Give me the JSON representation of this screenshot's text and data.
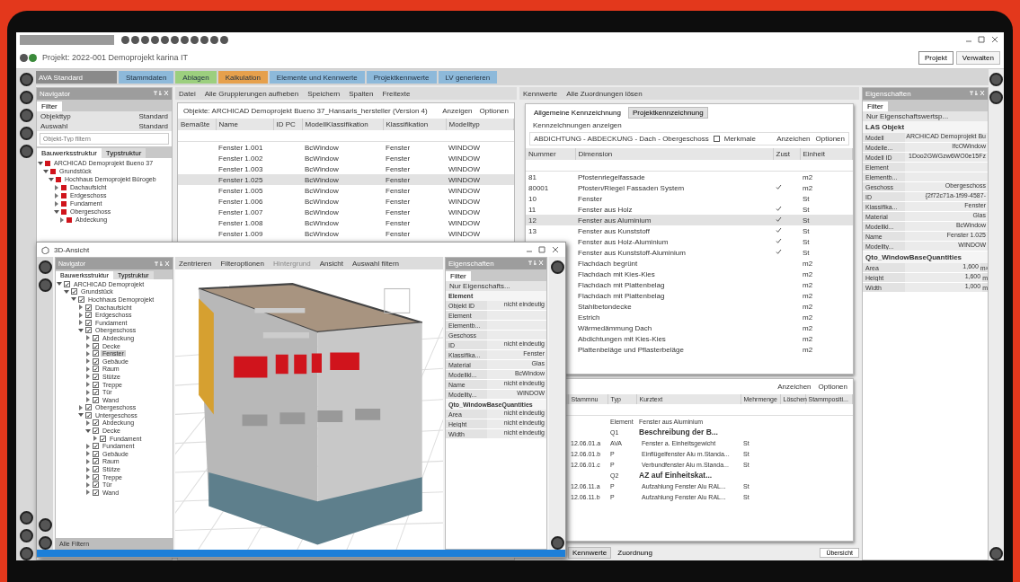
{
  "header": {
    "title": "Projekt: 2022-001 Demoprojekt karina IT",
    "tabs": [
      {
        "label": "Projekt",
        "selected": true
      },
      {
        "label": "Verwalten",
        "selected": false
      }
    ]
  },
  "ribbon": {
    "dropdown": "AVA Standard",
    "tabs": [
      {
        "label": "Stammdaten",
        "color": "#8db9da"
      },
      {
        "label": "Ablagen",
        "color": "#9ccf7e"
      },
      {
        "label": "Kalkulation",
        "color": "#e6a04c"
      },
      {
        "label": "Elemente und Kennwerte",
        "color": "#8db9da"
      },
      {
        "label": "Projektkennwerte",
        "color": "#8db9da"
      },
      {
        "label": "LV generieren",
        "color": "#8db9da"
      }
    ]
  },
  "navigator": {
    "title": "Navigator",
    "filter_tab": "Filter",
    "filters": [
      {
        "label": "Objekttyp",
        "value": "Standard"
      },
      {
        "label": "Auswahl",
        "value": "Standard"
      }
    ],
    "search": {
      "placeholder": "Objekt-Typ filtern"
    },
    "tabs": [
      {
        "label": "Bauwerksstruktur",
        "selected": true
      },
      {
        "label": "Typstruktur",
        "selected": false
      }
    ],
    "tree": [
      {
        "label": "ARCHICAD Demoprojekt Bueno 37",
        "expanded": true,
        "selected": false,
        "children": [
          {
            "label": "Grundstück",
            "expanded": true,
            "selected": false,
            "children": [
              {
                "label": "Hochhaus Demoprojekt Bürogeb",
                "expanded": true,
                "selected": false,
                "children": [
                  {
                    "label": "Dachaufsicht",
                    "expanded": false,
                    "selected": false
                  },
                  {
                    "label": "Erdgeschoss",
                    "expanded": false,
                    "selected": false
                  },
                  {
                    "label": "Fundament",
                    "expanded": false,
                    "selected": false
                  },
                  {
                    "label": "Obergeschoss",
                    "expanded": true,
                    "selected": false,
                    "children": [
                      {
                        "label": "Abdeckung",
                        "expanded": false,
                        "selected": false
                      }
                    ]
                  }
                ]
              }
            ]
          }
        ]
      }
    ]
  },
  "center": {
    "toolbar": [
      "Datei",
      "Alle Gruppierungen aufheben",
      "Speichern",
      "Spalten",
      "Freitexte"
    ],
    "caption": "Objekte: ARCHICAD Demoprojekt Bueno 37_Hansaris_hersteller (Version 4)",
    "actions": [
      "Anzeigen",
      "Optionen"
    ],
    "columns": [
      "Bemaßte",
      "Name",
      "ID PC",
      "ModellKlassifikation",
      "Klassifikation",
      "Modelltyp"
    ],
    "rows": [
      {
        "cells": [
          "",
          "Fenster 1.001",
          "",
          "BcWindow",
          "Fenster",
          "WINDOW"
        ],
        "selected": false
      },
      {
        "cells": [
          "",
          "Fenster 1.002",
          "",
          "BcWindow",
          "Fenster",
          "WINDOW"
        ],
        "selected": false
      },
      {
        "cells": [
          "",
          "Fenster 1.003",
          "",
          "BcWindow",
          "Fenster",
          "WINDOW"
        ],
        "selected": false
      },
      {
        "cells": [
          "",
          "Fenster 1.025",
          "",
          "BcWindow",
          "Fenster",
          "WINDOW"
        ],
        "selected": true
      },
      {
        "cells": [
          "",
          "Fenster 1.005",
          "",
          "BcWindow",
          "Fenster",
          "WINDOW"
        ],
        "selected": false
      },
      {
        "cells": [
          "",
          "Fenster 1.006",
          "",
          "BcWindow",
          "Fenster",
          "WINDOW"
        ],
        "selected": false
      },
      {
        "cells": [
          "",
          "Fenster 1.007",
          "",
          "BcWindow",
          "Fenster",
          "WINDOW"
        ],
        "selected": false
      },
      {
        "cells": [
          "",
          "Fenster 1.008",
          "",
          "BcWindow",
          "Fenster",
          "WINDOW"
        ],
        "selected": false
      },
      {
        "cells": [
          "",
          "Fenster 1.009",
          "",
          "BcWindow",
          "Fenster",
          "WINDOW"
        ],
        "selected": false
      }
    ]
  },
  "middle": {
    "toolbar": [
      "Kennwerte",
      "Alle Zuordnungen lösen"
    ],
    "tabs": [
      {
        "label": "Allgemeine Kennzeichnung",
        "selected": false
      },
      {
        "label": "Projektkennzeichnung",
        "selected": true
      }
    ],
    "hint": "Kennzeichnungen anzeigen",
    "filter_path": "ABDICHTUNG - ABDECKUNG - Dach - Obergeschoss",
    "filter_check": {
      "label": "Merkmale",
      "checked": false
    },
    "actions": [
      "Anzeichen",
      "Optionen"
    ],
    "columns": [
      "Nummer",
      "Dimension",
      "Zust",
      "Einheit"
    ],
    "rows": [
      {
        "number": "81",
        "name": "Pfostenriegelfassade",
        "checked": false,
        "unit": "m2",
        "selected": false
      },
      {
        "number": "80001",
        "name": "Pfosten/Riegel Fassaden System",
        "checked": true,
        "unit": "m2",
        "selected": false
      },
      {
        "number": "10",
        "name": "Fenster",
        "checked": false,
        "unit": "St",
        "selected": false
      },
      {
        "number": "11",
        "name": "Fenster aus Holz",
        "checked": true,
        "unit": "St",
        "selected": false
      },
      {
        "number": "12",
        "name": "Fenster aus Aluminium",
        "checked": true,
        "unit": "St",
        "selected": true
      },
      {
        "number": "13",
        "name": "Fenster aus Kunststoff",
        "checked": true,
        "unit": "St",
        "selected": false
      },
      {
        "name": "Fenster aus Holz-Aluminium",
        "checked": true,
        "unit": "St",
        "selected": false
      },
      {
        "name": "Fenster aus Kunststoff-Aluminium",
        "checked": true,
        "unit": "St",
        "selected": false
      },
      {
        "name": "Flachdach begrünt",
        "checked": false,
        "unit": "m2",
        "selected": false
      },
      {
        "name": "Flachdach mit Kies-Kies",
        "checked": false,
        "unit": "m2",
        "selected": false
      },
      {
        "name": "Flachdach mit Plattenbelag",
        "checked": false,
        "unit": "m2",
        "selected": false
      },
      {
        "name": "Flachdach mit Plattenbelag",
        "checked": false,
        "unit": "m2",
        "selected": false
      },
      {
        "name": "Stahlbetondecke",
        "checked": false,
        "unit": "m2",
        "selected": false
      },
      {
        "name": "Estrich",
        "checked": false,
        "unit": "m2",
        "selected": false
      },
      {
        "name": "Wärmedämmung Dach",
        "checked": false,
        "unit": "m2",
        "selected": false
      },
      {
        "name": "Abdichtungen mit Kies-Kies",
        "checked": false,
        "unit": "m2",
        "selected": false
      },
      {
        "name": "Plattenbeläge und Pflasterbeläge",
        "checked": false,
        "unit": "m2",
        "selected": false
      }
    ]
  },
  "positions": {
    "actions": [
      "Anzeichen",
      "Optionen"
    ],
    "columns": [
      "Stammnu",
      "Typ",
      "Kurztext",
      "Mehrmenge",
      "Löschen",
      "Stammpositi..."
    ],
    "rows": [
      {
        "kind": "element",
        "type": "Element",
        "text": "Fenster aus Aluminium"
      },
      {
        "kind": "heading",
        "type": "Q1",
        "text": "Beschreibung der B..."
      },
      {
        "kind": "item",
        "code": "12.06.01.a",
        "type": "AVA",
        "text": "Fenster a. Einheitsgewicht",
        "unit": "St"
      },
      {
        "kind": "item",
        "code": "12.06.01.b",
        "type": "P",
        "text": "Einflügelfenster Alu m.Standa...",
        "unit": "St"
      },
      {
        "kind": "item",
        "code": "12.06.01.c",
        "type": "P",
        "text": "Verbundfenster Alu m.Standa...",
        "unit": "St"
      },
      {
        "kind": "heading",
        "type": "Q2",
        "text": "AZ auf Einheitskat..."
      },
      {
        "kind": "item",
        "code": "12.06.11.a",
        "type": "P",
        "text": "Aufzahlung Fenster Alu RAL...",
        "unit": "St"
      },
      {
        "kind": "item",
        "code": "12.06.11.b",
        "type": "P",
        "text": "Aufzahlung Fenster Alu RAL...",
        "unit": "St"
      }
    ],
    "footer_tabs": [
      {
        "label": "Kennwerte",
        "selected": true
      },
      {
        "label": "Zuordnung",
        "selected": false
      }
    ],
    "view_select": "Übersicht"
  },
  "properties": {
    "title": "Eigenschaften",
    "filter_tab": "Filter",
    "dropdown": "Nur Eigenschaftswertsp...",
    "section": "LAS Objekt",
    "rows": [
      [
        "Modell",
        "ARCHICAD Demoprojekt Bu"
      ],
      [
        "Modelle...",
        "IfcOWindow"
      ],
      [
        "Modell ID",
        "1Doo2GWGzw6WO0e15Fz"
      ],
      [
        "Element",
        ""
      ],
      [
        "Elementb...",
        ""
      ],
      [
        "Geschoss",
        "Obergeschoss"
      ],
      [
        "ID",
        "{2f72c71a-1f99-4587-"
      ],
      [
        "Klassifika...",
        "Fenster"
      ],
      [
        "Material",
        "Glas"
      ],
      [
        "Modellkl...",
        "BcWindow"
      ],
      [
        "Name",
        "Fenster 1.025"
      ],
      [
        "Modellty...",
        "WINDOW"
      ]
    ],
    "group": "Qto_WindowBaseQuantities",
    "quantities": [
      [
        "Area",
        "1,600",
        "m²"
      ],
      [
        "Height",
        "1,600",
        "m"
      ],
      [
        "Width",
        "1,000",
        "m"
      ]
    ]
  },
  "view_3d": {
    "title": "3D-Ansicht",
    "navigator": {
      "title": "Navigator",
      "tabs": [
        {
          "label": "Bauwerksstruktur",
          "selected": true
        },
        {
          "label": "Typstruktur",
          "selected": false
        }
      ],
      "tree": [
        {
          "label": "ARCHICAD Demoprojekt",
          "expanded": true,
          "checked": true,
          "selected": false,
          "children": [
            {
              "label": "Grundstück",
              "expanded": true,
              "checked": true,
              "selected": false,
              "children": [
                {
                  "label": "Hochhaus Demoprojekt",
                  "expanded": true,
                  "checked": true,
                  "selected": false,
                  "children": [
                    {
                      "label": "Dachaufsicht",
                      "expanded": false,
                      "checked": true,
                      "selected": false
                    },
                    {
                      "label": "Erdgeschoss",
                      "expanded": false,
                      "checked": true,
                      "selected": false
                    },
                    {
                      "label": "Fundament",
                      "expanded": false,
                      "checked": true,
                      "selected": false
                    },
                    {
                      "label": "Obergeschoss",
                      "expanded": true,
                      "checked": true,
                      "selected": false,
                      "children": [
                        {
                          "label": "Abdeckung",
                          "expanded": false,
                          "checked": true,
                          "selected": false
                        },
                        {
                          "label": "Decke",
                          "expanded": false,
                          "checked": true,
                          "selected": false
                        },
                        {
                          "label": "Fenster",
                          "expanded": false,
                          "checked": true,
                          "selected": true
                        },
                        {
                          "label": "Gebäude",
                          "expanded": false,
                          "checked": true,
                          "selected": false
                        },
                        {
                          "label": "Raum",
                          "expanded": false,
                          "checked": true,
                          "selected": false
                        },
                        {
                          "label": "Stütze",
                          "expanded": false,
                          "checked": true,
                          "selected": false
                        },
                        {
                          "label": "Treppe",
                          "expanded": false,
                          "checked": true,
                          "selected": false
                        },
                        {
                          "label": "Tür",
                          "expanded": false,
                          "checked": true,
                          "selected": false
                        },
                        {
                          "label": "Wand",
                          "expanded": false,
                          "checked": true,
                          "selected": false
                        }
                      ]
                    },
                    {
                      "label": "Obergeschoss",
                      "expanded": false,
                      "checked": true,
                      "selected": false
                    },
                    {
                      "label": "Untergeschoss",
                      "expanded": true,
                      "checked": true,
                      "selected": false,
                      "children": [
                        {
                          "label": "Abdeckung",
                          "expanded": false,
                          "checked": true,
                          "selected": false
                        },
                        {
                          "label": "Decke",
                          "expanded": true,
                          "checked": true,
                          "selected": false,
                          "children": [
                            {
                              "label": "Fundament",
                              "expanded": false,
                              "checked": true,
                              "selected": false
                            }
                          ]
                        },
                        {
                          "label": "Fundament",
                          "expanded": false,
                          "checked": true,
                          "selected": false
                        },
                        {
                          "label": "Gebäude",
                          "expanded": false,
                          "checked": true,
                          "selected": false
                        },
                        {
                          "label": "Raum",
                          "expanded": false,
                          "checked": true,
                          "selected": false
                        },
                        {
                          "label": "Stütze",
                          "expanded": false,
                          "checked": true,
                          "selected": false
                        },
                        {
                          "label": "Treppe",
                          "expanded": false,
                          "checked": true,
                          "selected": false
                        },
                        {
                          "label": "Tür",
                          "expanded": false,
                          "checked": true,
                          "selected": false
                        },
                        {
                          "label": "Wand",
                          "expanded": false,
                          "checked": true,
                          "selected": false
                        }
                      ]
                    }
                  ]
                }
              ]
            }
          ]
        }
      ],
      "footer": "Alle Filtern"
    },
    "toolbar": [
      {
        "label": "Zentrieren",
        "disabled": false
      },
      {
        "label": "Filteroptionen",
        "disabled": false
      },
      {
        "label": "Hintergrund",
        "disabled": true
      },
      {
        "label": "Ansicht",
        "disabled": false
      },
      {
        "label": "Auswahl filtern",
        "disabled": false
      }
    ],
    "properties": {
      "title": "Eigenschaften",
      "filter_tab": "Filter",
      "dropdown": "Nur Eigenschafts...",
      "section": "Element",
      "rows": [
        [
          "Objekt ID",
          "nicht eindeutig"
        ],
        [
          "Element",
          ""
        ],
        [
          "Elementb...",
          ""
        ],
        [
          "Geschoss",
          ""
        ],
        [
          "ID",
          "nicht eindeutig"
        ],
        [
          "Klassifika...",
          "Fenster"
        ],
        [
          "Material",
          "Glas"
        ],
        [
          "Modellkl...",
          "BcWindow"
        ],
        [
          "Name",
          "nicht eindeutig"
        ],
        [
          "Modellty...",
          "WINDOW"
        ]
      ],
      "group": "Qto_WindowBaseQuantities",
      "quantities": [
        [
          "Area",
          "nicht eindeutig"
        ],
        [
          "Height",
          "nicht eindeutig"
        ],
        [
          "Width",
          "nicht eindeutig"
        ]
      ]
    }
  }
}
